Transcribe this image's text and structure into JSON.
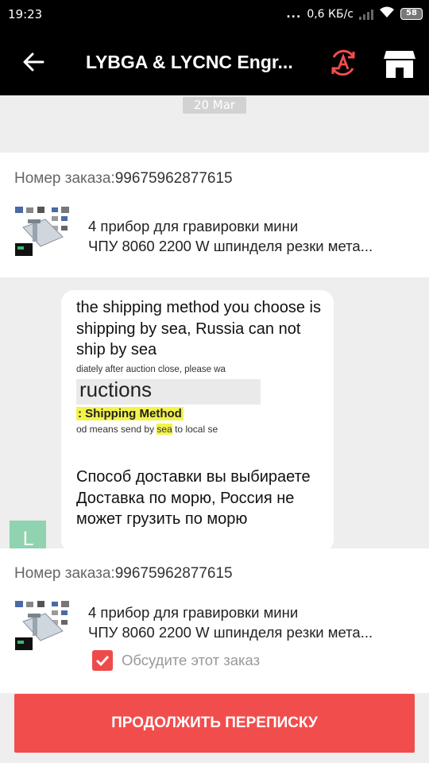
{
  "status_bar": {
    "time": "19:23",
    "dots": "...",
    "speed": "0,6 КБ/с",
    "battery": "58"
  },
  "header": {
    "title": "LYBGA & LYCNC Engr..."
  },
  "chat": {
    "date": "20 Mar",
    "order_top": {
      "label": "Номер заказа:",
      "number": "99675962877615",
      "product_line1": "4 прибор для гравировки мини",
      "product_line2": "ЧПУ 8060 2200 W шпинделя резки мета..."
    },
    "message": {
      "avatar_letter": "L",
      "text_en": "the shipping method you choose is shipping by sea, Russia can not ship by sea",
      "screenshot": {
        "line1": "diately after auction close, please wa",
        "line2": "ructions",
        "line3": ": Shipping Method",
        "line4_before": "od means send by ",
        "line4_highlight": "sea",
        "line4_after": " to local se"
      },
      "text_ru": "Способ доставки вы выбираете Доставка по морю, Россия не может грузить по морю"
    }
  },
  "footer": {
    "order_label": "Номер заказа:",
    "order_number": "99675962877615",
    "product_line1": "4 прибор для гравировки мини",
    "product_line2": "ЧПУ 8060 2200 W шпинделя резки мета...",
    "checkbox_label": "Обсудите этот заказ",
    "checkbox_checked": true,
    "continue_button": "ПРОДОЛЖИТЬ ПЕРЕПИСКУ"
  },
  "colors": {
    "accent": "#f24d4d",
    "appbar": "#000000",
    "avatar": "#8fd3b0",
    "highlight": "#f3f34a"
  }
}
